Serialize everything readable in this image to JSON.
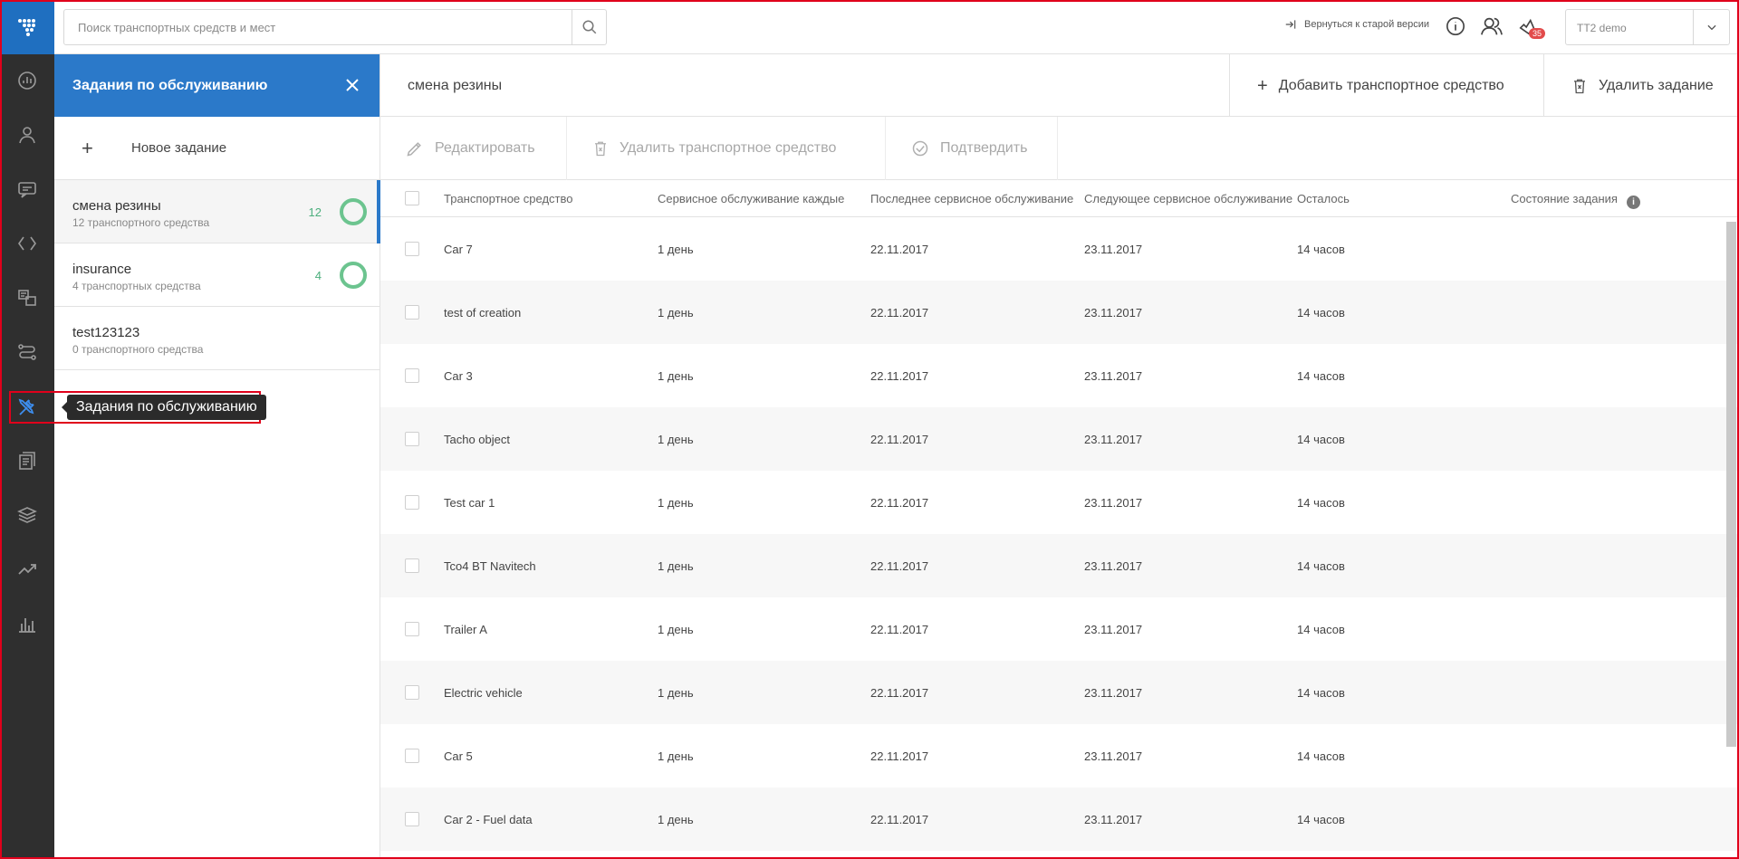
{
  "topbar": {
    "search_placeholder": "Поиск транспортных средств и мест",
    "back_link": "Вернуться к старой версии",
    "notifications_count": "35",
    "account": "TT2 demo"
  },
  "rail": {
    "tooltip": "Задания по обслуживанию"
  },
  "panel": {
    "title": "Задания по обслуживанию",
    "new_task": "Новое задание",
    "tasks": [
      {
        "name": "смена резины",
        "sub": "12 транспортного средства",
        "count": "12"
      },
      {
        "name": "insurance",
        "sub": "4 транспортных средства",
        "count": "4"
      },
      {
        "name": "test123123",
        "sub": "0 транспортного средства",
        "count": ""
      }
    ]
  },
  "main": {
    "title": "смена резины",
    "add_vehicle": "Добавить транспортное средство",
    "delete_task": "Удалить задание",
    "edit": "Редактировать",
    "delete_vehicle": "Удалить транспортное средство",
    "confirm": "Подтвердить"
  },
  "table": {
    "columns": [
      "Транспортное средство",
      "Сервисное обслуживание каждые",
      "Последнее сервисное обслуживание",
      "Следующее сервисное обслуживание",
      "Осталось",
      "Состояние задания"
    ],
    "rows": [
      [
        "Car 7",
        "1 день",
        "22.11.2017",
        "23.11.2017",
        "14 часов"
      ],
      [
        "test of creation",
        "1 день",
        "22.11.2017",
        "23.11.2017",
        "14 часов"
      ],
      [
        "Car 3",
        "1 день",
        "22.11.2017",
        "23.11.2017",
        "14 часов"
      ],
      [
        "Tacho object",
        "1 день",
        "22.11.2017",
        "23.11.2017",
        "14 часов"
      ],
      [
        "Test car 1",
        "1 день",
        "22.11.2017",
        "23.11.2017",
        "14 часов"
      ],
      [
        "Tco4 BT Navitech",
        "1 день",
        "22.11.2017",
        "23.11.2017",
        "14 часов"
      ],
      [
        "Trailer A",
        "1 день",
        "22.11.2017",
        "23.11.2017",
        "14 часов"
      ],
      [
        "Electric vehicle",
        "1 день",
        "22.11.2017",
        "23.11.2017",
        "14 часов"
      ],
      [
        "Car 5",
        "1 день",
        "22.11.2017",
        "23.11.2017",
        "14 часов"
      ],
      [
        "Car 2 - Fuel data",
        "1 день",
        "22.11.2017",
        "23.11.2017",
        "14 часов"
      ]
    ]
  },
  "colors": {
    "accent": "#2b79c9",
    "rail": "#2f2f2f",
    "ring": "#6cc48f",
    "highlight": "#e0001b"
  }
}
